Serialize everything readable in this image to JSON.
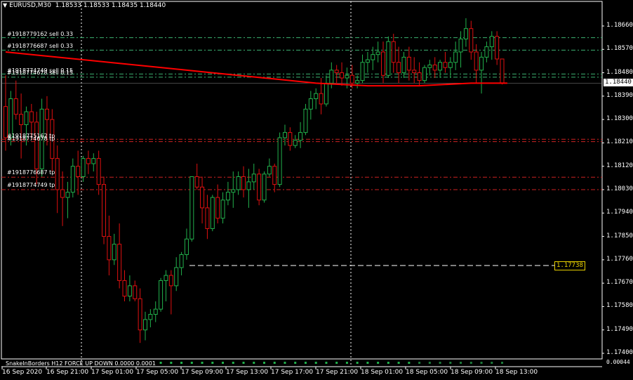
{
  "header": {
    "symbol": "EURUSD,M30",
    "ohlc": "1.18533 1.18533 1.18435 1.18440"
  },
  "orders": [
    {
      "label": "#1918779162 sell 0.33",
      "price": 1.18615,
      "color": "#3cb371"
    },
    {
      "label": "#1918776687 sell 0.33",
      "price": 1.18567,
      "color": "#3cb371"
    },
    {
      "label": "#1918774749 sell 0.15",
      "price": 1.18475,
      "color": "#3cb371"
    },
    {
      "label": "#1918774678 sell 0.15",
      "price": 1.18463,
      "color": "#3cb371"
    },
    {
      "label": "#1918775162 tp",
      "price": 1.18224,
      "color": "#cc2222"
    },
    {
      "label": "#1918774678 tp",
      "price": 1.18215,
      "color": "#cc2222"
    },
    {
      "label": "#1918776687 tp",
      "price": 1.18078,
      "color": "#cc2222"
    },
    {
      "label": "#1918774749 tp",
      "price": 1.1803,
      "color": "#cc2222"
    }
  ],
  "price_axis": {
    "ticks": [
      "1.18660",
      "1.18570",
      "1.18480",
      "1.18390",
      "1.18300",
      "1.18210",
      "1.18120",
      "1.18030",
      "1.17940",
      "1.17850",
      "1.17760",
      "1.17670",
      "1.17580",
      "1.17490",
      "1.17400"
    ],
    "current_price": "1.18440",
    "line_price": "1.17738",
    "sub_value": "0.00044"
  },
  "time_axis": {
    "ticks": [
      "16 Sep 2020",
      "16 Sep 21:00",
      "17 Sep 01:00",
      "17 Sep 05:00",
      "17 Sep 09:00",
      "17 Sep 13:00",
      "17 Sep 17:00",
      "17 Sep 21:00",
      "18 Sep 01:00",
      "18 Sep 05:00",
      "18 Sep 09:00",
      "18 Sep 13:00"
    ]
  },
  "indicator": {
    "caption": "SnakeInBorders H12  FORCE UP  DOWN  0.0000  0.0001"
  },
  "colors": {
    "bull": "#22b14c",
    "bear": "#e01010",
    "ma": "#ff0000",
    "grid": "#ffffff",
    "price_box_bg": "#ffffff",
    "line_box_bg": "#000000",
    "line_box_border": "#e8d000"
  },
  "candles": [
    [
      1.1835,
      1.1847,
      1.1818,
      1.1823
    ],
    [
      1.1823,
      1.1841,
      1.182,
      1.1838
    ],
    [
      1.1838,
      1.1845,
      1.183,
      1.1832
    ],
    [
      1.1832,
      1.184,
      1.1815,
      1.1828
    ],
    [
      1.1828,
      1.1835,
      1.182,
      1.1833
    ],
    [
      1.1833,
      1.1836,
      1.1823,
      1.1829
    ],
    [
      1.1829,
      1.1833,
      1.1805,
      1.1811
    ],
    [
      1.1811,
      1.1838,
      1.1808,
      1.1834
    ],
    [
      1.1834,
      1.1839,
      1.182,
      1.183
    ],
    [
      1.183,
      1.1834,
      1.181,
      1.1815
    ],
    [
      1.1815,
      1.182,
      1.1794,
      1.1803
    ],
    [
      1.1803,
      1.181,
      1.1789,
      1.18
    ],
    [
      1.18,
      1.1806,
      1.1792,
      1.1802
    ],
    [
      1.1802,
      1.1815,
      1.18,
      1.1812
    ],
    [
      1.1812,
      1.1818,
      1.1801,
      1.1808
    ],
    [
      1.1808,
      1.1816,
      1.1806,
      1.1815
    ],
    [
      1.1815,
      1.1818,
      1.1809,
      1.1813
    ],
    [
      1.1813,
      1.1817,
      1.181,
      1.1815
    ],
    [
      1.1815,
      1.1818,
      1.1801,
      1.1805
    ],
    [
      1.1805,
      1.1808,
      1.1782,
      1.1785
    ],
    [
      1.1785,
      1.1793,
      1.177,
      1.1776
    ],
    [
      1.1776,
      1.1786,
      1.1774,
      1.1782
    ],
    [
      1.1782,
      1.179,
      1.1765,
      1.1768
    ],
    [
      1.1768,
      1.1772,
      1.176,
      1.1762
    ],
    [
      1.1762,
      1.177,
      1.176,
      1.1766
    ],
    [
      1.1766,
      1.1768,
      1.176,
      1.1761
    ],
    [
      1.1761,
      1.1765,
      1.1744,
      1.1749
    ],
    [
      1.1749,
      1.1756,
      1.1745,
      1.1753
    ],
    [
      1.1753,
      1.1757,
      1.175,
      1.1755
    ],
    [
      1.1755,
      1.176,
      1.1752,
      1.1757
    ],
    [
      1.1757,
      1.1769,
      1.1756,
      1.1768
    ],
    [
      1.1768,
      1.1772,
      1.176,
      1.177
    ],
    [
      1.177,
      1.1772,
      1.1755,
      1.1766
    ],
    [
      1.1766,
      1.1777,
      1.1764,
      1.1773
    ],
    [
      1.1773,
      1.1779,
      1.177,
      1.1778
    ],
    [
      1.1778,
      1.1788,
      1.1776,
      1.1784
    ],
    [
      1.1784,
      1.1806,
      1.1783,
      1.1808
    ],
    [
      1.1808,
      1.1813,
      1.1803,
      1.1804
    ],
    [
      1.1804,
      1.1808,
      1.179,
      1.1796
    ],
    [
      1.1796,
      1.1801,
      1.1784,
      1.1788
    ],
    [
      1.1788,
      1.1801,
      1.1787,
      1.18
    ],
    [
      1.18,
      1.1805,
      1.179,
      1.1792
    ],
    [
      1.1792,
      1.1802,
      1.179,
      1.1799
    ],
    [
      1.1799,
      1.1806,
      1.1797,
      1.1802
    ],
    [
      1.1802,
      1.181,
      1.1796,
      1.1803
    ],
    [
      1.1803,
      1.181,
      1.1801,
      1.1808
    ],
    [
      1.1808,
      1.1812,
      1.18,
      1.1803
    ],
    [
      1.1803,
      1.1811,
      1.1796,
      1.1806
    ],
    [
      1.1806,
      1.1813,
      1.1803,
      1.1809
    ],
    [
      1.1809,
      1.1811,
      1.1797,
      1.1799
    ],
    [
      1.1799,
      1.181,
      1.1798,
      1.1809
    ],
    [
      1.1809,
      1.1815,
      1.1808,
      1.1812
    ],
    [
      1.1812,
      1.1813,
      1.1802,
      1.1805
    ],
    [
      1.1805,
      1.1825,
      1.1804,
      1.1823
    ],
    [
      1.1823,
      1.1828,
      1.182,
      1.1825
    ],
    [
      1.1825,
      1.1827,
      1.1818,
      1.182
    ],
    [
      1.182,
      1.1824,
      1.1819,
      1.1822
    ],
    [
      1.1822,
      1.1829,
      1.1819,
      1.1825
    ],
    [
      1.1825,
      1.1836,
      1.1824,
      1.1834
    ],
    [
      1.1834,
      1.1841,
      1.183,
      1.1838
    ],
    [
      1.1838,
      1.1842,
      1.1834,
      1.184
    ],
    [
      1.184,
      1.1846,
      1.1832,
      1.1836
    ],
    [
      1.1836,
      1.1847,
      1.1835,
      1.1844
    ],
    [
      1.1844,
      1.1852,
      1.1842,
      1.1849
    ],
    [
      1.1849,
      1.1851,
      1.1844,
      1.1848
    ],
    [
      1.1848,
      1.1852,
      1.1843,
      1.1846
    ],
    [
      1.1846,
      1.185,
      1.1842,
      1.1847
    ],
    [
      1.1847,
      1.1851,
      1.1842,
      1.1844
    ],
    [
      1.1844,
      1.1847,
      1.1842,
      1.1845
    ],
    [
      1.1845,
      1.1855,
      1.1844,
      1.1852
    ],
    [
      1.1852,
      1.1856,
      1.1848,
      1.1853
    ],
    [
      1.1853,
      1.1858,
      1.1849,
      1.1855
    ],
    [
      1.1855,
      1.186,
      1.1852,
      1.1856
    ],
    [
      1.1856,
      1.186,
      1.1844,
      1.1847
    ],
    [
      1.1847,
      1.1862,
      1.1846,
      1.186
    ],
    [
      1.186,
      1.1863,
      1.1848,
      1.1852
    ],
    [
      1.1852,
      1.1858,
      1.1844,
      1.1848
    ],
    [
      1.1848,
      1.1856,
      1.1846,
      1.1854
    ],
    [
      1.1854,
      1.1858,
      1.1845,
      1.1849
    ],
    [
      1.1849,
      1.1854,
      1.1844,
      1.1848
    ],
    [
      1.1848,
      1.1852,
      1.1843,
      1.1845
    ],
    [
      1.1845,
      1.1851,
      1.1844,
      1.185
    ],
    [
      1.185,
      1.1853,
      1.1847,
      1.1851
    ],
    [
      1.1851,
      1.1854,
      1.1846,
      1.1849
    ],
    [
      1.1849,
      1.1853,
      1.1846,
      1.1852
    ],
    [
      1.1852,
      1.1856,
      1.1848,
      1.185
    ],
    [
      1.185,
      1.1854,
      1.1846,
      1.1852
    ],
    [
      1.1852,
      1.186,
      1.1849,
      1.1856
    ],
    [
      1.1856,
      1.1864,
      1.185,
      1.1861
    ],
    [
      1.1861,
      1.1869,
      1.1858,
      1.1865
    ],
    [
      1.1865,
      1.1868,
      1.1853,
      1.1856
    ],
    [
      1.1856,
      1.1859,
      1.1844,
      1.1849
    ],
    [
      1.1849,
      1.1856,
      1.184,
      1.1854
    ],
    [
      1.1854,
      1.186,
      1.1852,
      1.1858
    ],
    [
      1.1858,
      1.1864,
      1.1853,
      1.1862
    ],
    [
      1.1862,
      1.1864,
      1.1851,
      1.18533
    ],
    [
      1.18533,
      1.18533,
      1.18435,
      1.1844
    ]
  ],
  "ma_line": [
    [
      0,
      1.1856
    ],
    [
      10,
      1.1854
    ],
    [
      20,
      1.1852
    ],
    [
      30,
      1.185
    ],
    [
      40,
      1.1848
    ],
    [
      50,
      1.1846
    ],
    [
      60,
      1.1844
    ],
    [
      70,
      1.1843
    ],
    [
      80,
      1.1843
    ],
    [
      90,
      1.1844
    ],
    [
      97,
      1.1844
    ]
  ]
}
